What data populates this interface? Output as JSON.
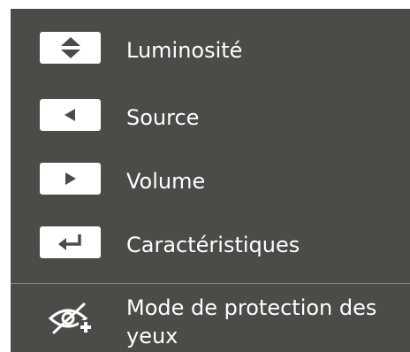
{
  "menu": {
    "items": [
      {
        "label": "Luminosité",
        "icon": "up-down-arrows-icon"
      },
      {
        "label": "Source",
        "icon": "arrow-left-icon"
      },
      {
        "label": "Volume",
        "icon": "arrow-right-icon"
      },
      {
        "label": "Caractéristiques",
        "icon": "enter-return-icon"
      }
    ],
    "eye_saver": {
      "label": "Mode de protection des yeux",
      "icon": "eye-saver-icon"
    }
  },
  "colors": {
    "panel_bg": "#4d4b48",
    "key_bg": "#ffffff",
    "key_glyph": "#4d4b48",
    "text": "#ffffff",
    "divider": "#8a8884"
  }
}
